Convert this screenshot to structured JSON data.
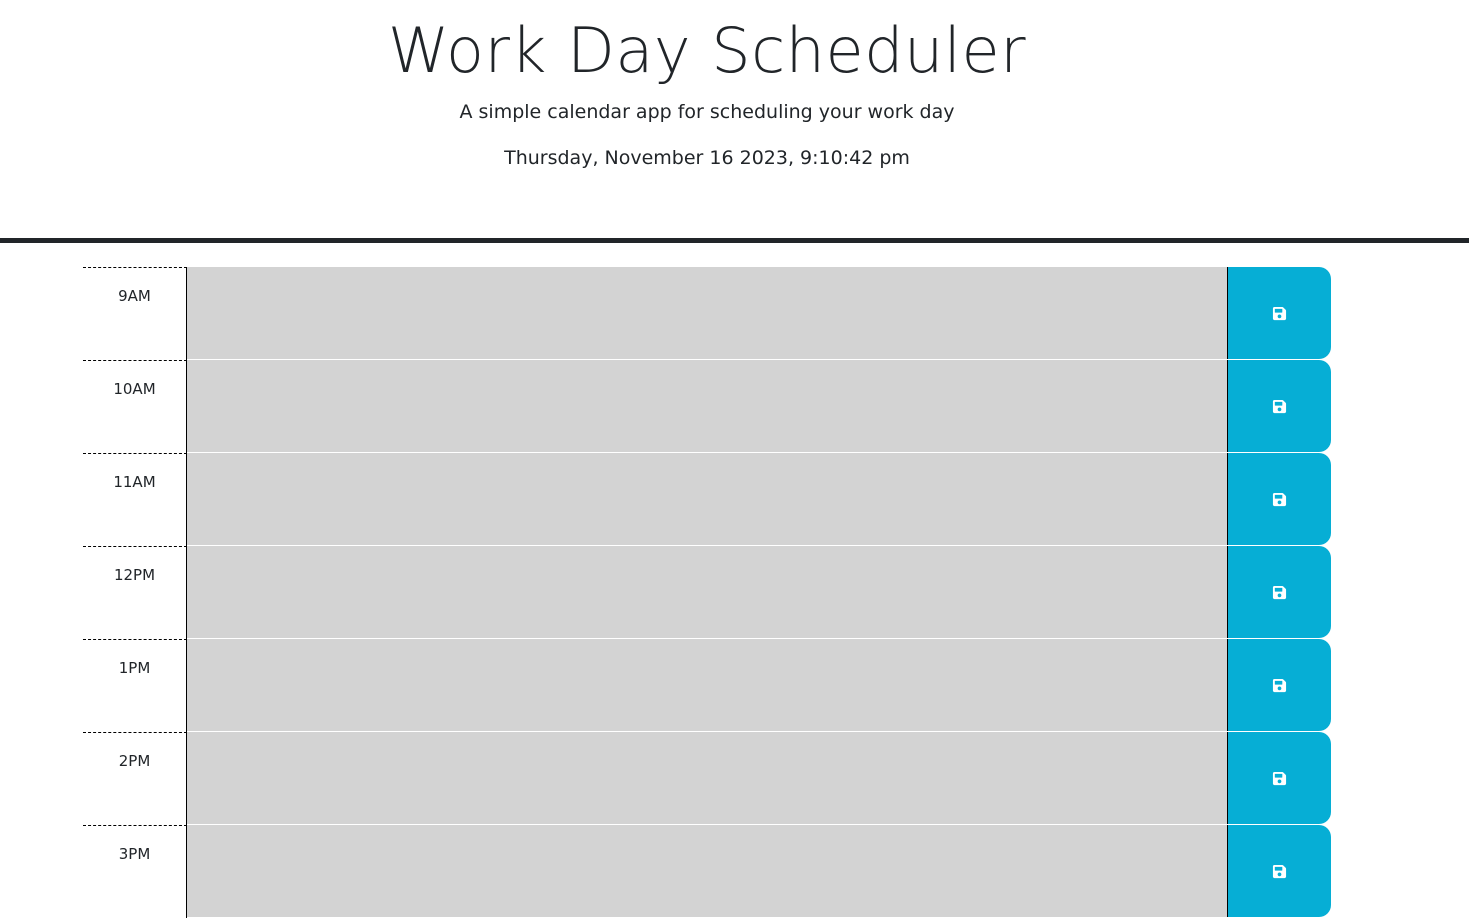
{
  "header": {
    "title": "Work Day Scheduler",
    "subtitle": "A simple calendar app for scheduling your work day",
    "current_day": "Thursday, November 16 2023, 9:10:42 pm"
  },
  "colors": {
    "past": "#d3d3d3",
    "save_button": "#06aed5",
    "text": "#212529"
  },
  "time_blocks": [
    {
      "hour": "9AM",
      "description": "",
      "icon": "save-icon"
    },
    {
      "hour": "10AM",
      "description": "",
      "icon": "save-icon"
    },
    {
      "hour": "11AM",
      "description": "",
      "icon": "save-icon"
    },
    {
      "hour": "12PM",
      "description": "",
      "icon": "save-icon"
    },
    {
      "hour": "1PM",
      "description": "",
      "icon": "save-icon"
    },
    {
      "hour": "2PM",
      "description": "",
      "icon": "save-icon"
    },
    {
      "hour": "3PM",
      "description": "",
      "icon": "save-icon"
    }
  ]
}
